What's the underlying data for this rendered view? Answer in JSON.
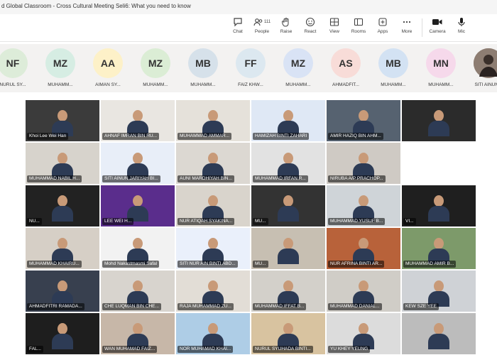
{
  "window": {
    "title": "d Global Classroom - Cross Cultural Meeting Seli6: What you need to know"
  },
  "toolbar": [
    {
      "key": "chat",
      "label": "Chat",
      "icon": "chat-icon"
    },
    {
      "key": "people",
      "label": "People",
      "icon": "people-icon",
      "count": "111"
    },
    {
      "key": "raise",
      "label": "Raise",
      "icon": "raise-hand-icon"
    },
    {
      "key": "react",
      "label": "React",
      "icon": "react-icon"
    },
    {
      "key": "view",
      "label": "View",
      "icon": "view-icon"
    },
    {
      "key": "rooms",
      "label": "Rooms",
      "icon": "rooms-icon"
    },
    {
      "key": "apps",
      "label": "Apps",
      "icon": "apps-icon"
    },
    {
      "key": "more",
      "label": "More",
      "icon": "more-icon"
    },
    {
      "key": "camera",
      "label": "Camera",
      "icon": "camera-icon"
    },
    {
      "key": "mic",
      "label": "Mic",
      "icon": "mic-icon"
    }
  ],
  "strip": [
    {
      "initials": "NF",
      "name": "NURUL SY...",
      "color": "#ddecd9"
    },
    {
      "initials": "MZ",
      "name": "MUHAMM...",
      "color": "#d6ede3"
    },
    {
      "initials": "AA",
      "name": "AIMAN SY...",
      "color": "#fdf1c8"
    },
    {
      "initials": "MZ",
      "name": "MUHAMM...",
      "color": "#dbedd5"
    },
    {
      "initials": "MB",
      "name": "MUHAMM...",
      "color": "#d6e1ea"
    },
    {
      "initials": "FF",
      "name": "FAIZ KHW...",
      "color": "#dce8f0"
    },
    {
      "initials": "MZ",
      "name": "MUHAMM...",
      "color": "#d9e3f5"
    },
    {
      "initials": "AS",
      "name": "AHMADFIT...",
      "color": "#f8dcd8"
    },
    {
      "initials": "MB",
      "name": "MUHAMM...",
      "color": "#d3e2f3"
    },
    {
      "initials": "MN",
      "name": "MUHAMM...",
      "color": "#f6d9eb"
    },
    {
      "initials": "",
      "name": "SITI AINUN...",
      "color": "#7a6a60"
    }
  ],
  "tiles": [
    [
      "Khoi Lee Wei Han",
      "AHNAF IMRAN BIN RU...",
      "MUHAMMAD AMMAR...",
      "HAMIZAH BINTI ZAHARI",
      "AMIR HAZIQ BIN AHM...",
      ""
    ],
    [
      "MUHAMMAD NABIL H...",
      "SITI AINUN JARIYAH BI...",
      "AUNI MARDHIYAH BIN...",
      "MUHAMMAD IRFAN R...",
      "NIRUBA A/P PRACHOP..."
    ],
    [
      "NU...",
      "LEE WEI H...",
      "NUR ATIQAH SYAKINA...",
      "MU...",
      "MUHAMMAD YUSUF B...",
      "VI..."
    ],
    [
      "MUHAMMAD KHAIRU...",
      "Mohd Nakastmasmi Safal",
      "SITI NUR AIN BINTI ABD...",
      "MU...",
      "NUR AFRINA BINTI AR...",
      "MUHAMMAD AMIR B..."
    ],
    [
      "AHMADFITRI RAMADA...",
      "CHE LUQMAN BIN CHE...",
      "RAJA MUHAMMAD ZU...",
      "MUHAMMAD IFFAT B...",
      "MUHAMMAD DANIAL...",
      "KEW SZE YEE"
    ],
    [
      "FAL...",
      "WAN MUHAMAD FAIZ...",
      "NOR MUHAMAD KHAI...",
      "NURUL SYUHADA BINTI...",
      "YU KHEY YEUNG",
      ""
    ]
  ]
}
